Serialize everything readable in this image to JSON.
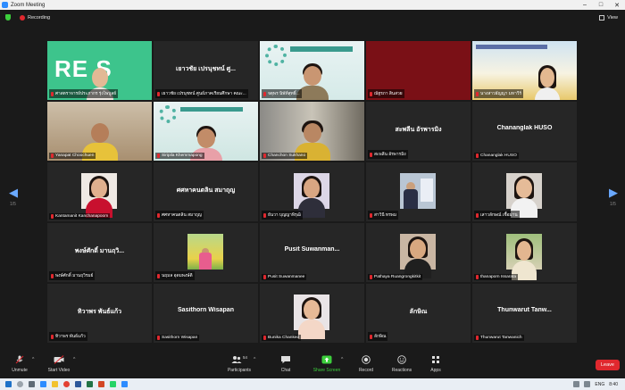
{
  "window": {
    "title": "Zoom Meeting"
  },
  "topbar": {
    "recording": "Recording",
    "view": "View"
  },
  "pages": {
    "left": "1/5",
    "right": "1/5"
  },
  "participants": [
    {
      "label": "ศาสตราจารย์ประภากร รุ่งไพบูลย์"
    },
    {
      "center": "เยาวชัย เปรนุชทน์ ศู...",
      "label": "เยาวชัย เปรนุชทน์ ศูนย์ภาคเรียนศึกษา คณะ..."
    },
    {
      "label": "จตุพร นิพัท์สุทธิ์..."
    },
    {
      "label": "ณัฐรภา สินสวย"
    },
    {
      "label": "นางสาวธัญญา มหาวีร์"
    },
    {
      "label": "Yanapat Choochuen"
    },
    {
      "label": "Siripila Khemmapong"
    },
    {
      "label": "Chanchon Sukhano"
    },
    {
      "center": "สะพลีน อัรพารมิง",
      "label": "สะพลีน อัรพารมิง"
    },
    {
      "center": "Chananglak HUSO",
      "label": "Chananglak HUSO"
    },
    {
      "label": "Kantamanit Kanchanapoom"
    },
    {
      "center": "ศศหาคนตลิน สมาฤุญ",
      "label": "ศศหาคนตลิน สมาฤุญ"
    },
    {
      "label": "ธันวา บุญญาพิรุฒิ"
    },
    {
      "label": "สาวินี ทรพม"
    },
    {
      "label": "เสาวลักษณ์ เชื้อมาน"
    },
    {
      "center": "พงษ์ศักดิ์ มานฤวิ...",
      "label": "พงษ์ศักดิ์ มานฤวิรมย์"
    },
    {
      "label": "นฤมล อุดมพงษ์ดี"
    },
    {
      "center": "Pusit Suwanman...",
      "label": "Pusit Suwanmanee"
    },
    {
      "label": "Pathaya Ruangrongkitkit"
    },
    {
      "label": "thanaporn Issarata"
    },
    {
      "center": "ทิวาพร พันธ์แก้ว",
      "label": "ทิวาพร พันธ์แก้ว"
    },
    {
      "center": "Sasithorn Wisapan",
      "label": "Sasithorn Wisapan"
    },
    {
      "label": "Bunika Chanked"
    },
    {
      "center": "ลักษิณ",
      "label": "ลักษิณ"
    },
    {
      "center": "Thunwarut Tanw...",
      "label": "Thunwarut Tanwanich"
    }
  ],
  "toolbar": {
    "unmute": "Unmute",
    "start_video": "Start Video",
    "participants": "Participants",
    "participants_count": "54",
    "chat": "Chat",
    "share_screen": "Share Screen",
    "record": "Record",
    "reactions": "Reactions",
    "apps": "Apps",
    "leave": "Leave"
  },
  "taskbar": {
    "lang": "ENG",
    "time": "8:40"
  },
  "colors": {
    "accent": "#2d8cff",
    "share": "#3ccf3c",
    "leave": "#e0282e",
    "active_speaker": "#e6e34a"
  }
}
